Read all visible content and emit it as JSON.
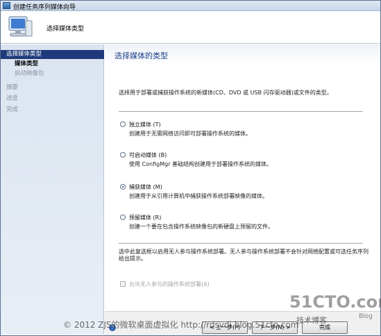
{
  "window": {
    "title": "创建任务序列媒体向导"
  },
  "header": {
    "title": "选择媒体类型"
  },
  "nav": {
    "items": [
      {
        "label": "选择媒体类型",
        "state": "active"
      },
      {
        "label": "媒体类型",
        "state": "current"
      },
      {
        "label": "启动映像包",
        "state": "sub"
      },
      {
        "label": "摘要",
        "state": "disabled"
      },
      {
        "label": "进度",
        "state": "disabled"
      },
      {
        "label": "完成",
        "state": "disabled"
      }
    ]
  },
  "content": {
    "title": "选择媒体的类型",
    "description": "选择用于部署或捕获操作系统的新媒体(CD、DVD 或 USB 闪存驱动器)或文件的类型。",
    "options": [
      {
        "label": "独立媒体 (T)",
        "desc": "创建用于无需网络访问即可部署操作系统的媒体。",
        "checked": false
      },
      {
        "label": "可启动媒体 (B)",
        "desc": "使用 ConfigMgr 基础结构创建用于部署操作系统的媒体。",
        "checked": false
      },
      {
        "label": "捕获媒体 (M)",
        "desc": "创建用于从引用计算机中捕获操作系统部署映像的媒体。",
        "checked": true
      },
      {
        "label": "预留媒体 (R)",
        "desc": "创建一个要在包含操作系统映像包的新硬盘上预留的文件。",
        "checked": false
      }
    ],
    "note": "选中此复选框以启用无人参与操作系统部署。无人参与操作系统部署不会针对网络配置或可选任务序列给出提示。",
    "checkbox_label": "允许无人参与的操作系统部署(A)"
  },
  "footer": {
    "prev_label": "< 上一步(P)",
    "next_label": "下一步(N) >",
    "finish_label": "完成"
  },
  "watermark": {
    "text": "© 2012 ZJS的微软桌面虚拟化 http://rdsvdi.blog.51cto.com",
    "logo": "51CTO.com",
    "logo_sub": "技术博客",
    "logo_blog": "Blog"
  }
}
